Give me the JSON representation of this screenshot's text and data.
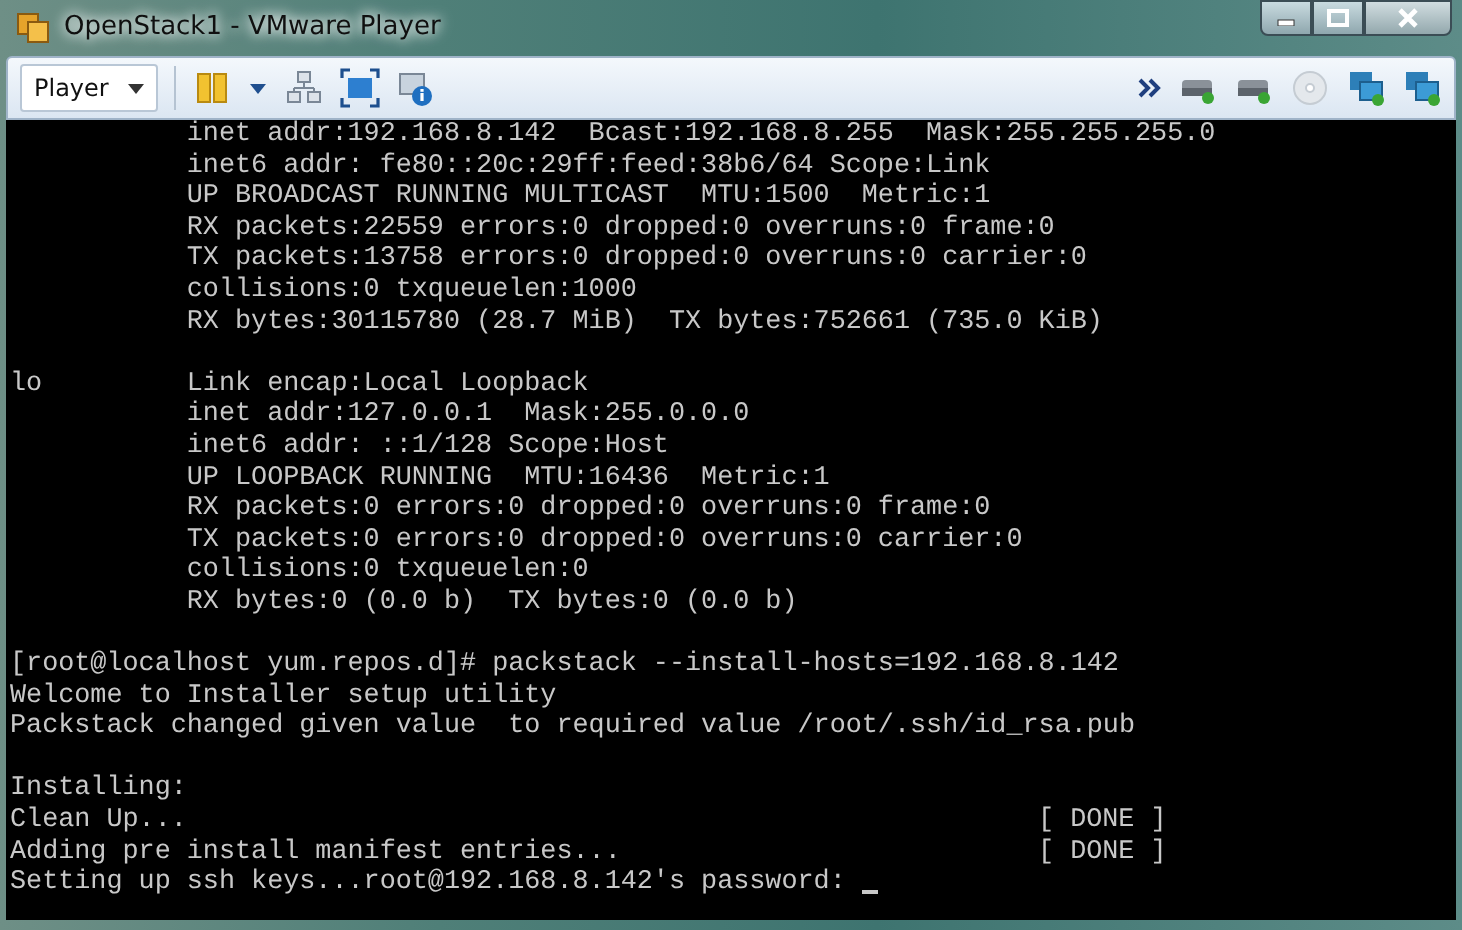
{
  "window": {
    "title": "OpenStack1 - VMware Player"
  },
  "toolbar": {
    "menu_label": "Player"
  },
  "terminal": {
    "blocks": [
      {
        "lines": [
          "           inet addr:192.168.8.142  Bcast:192.168.8.255  Mask:255.255.255.0",
          "           inet6 addr: fe80::20c:29ff:feed:38b6/64 Scope:Link",
          "           UP BROADCAST RUNNING MULTICAST  MTU:1500  Metric:1",
          "           RX packets:22559 errors:0 dropped:0 overruns:0 frame:0",
          "           TX packets:13758 errors:0 dropped:0 overruns:0 carrier:0",
          "           collisions:0 txqueuelen:1000",
          "           RX bytes:30115780 (28.7 MiB)  TX bytes:752661 (735.0 KiB)"
        ]
      },
      {
        "lines": [
          "lo         Link encap:Local Loopback",
          "           inet addr:127.0.0.1  Mask:255.0.0.0",
          "           inet6 addr: ::1/128 Scope:Host",
          "           UP LOOPBACK RUNNING  MTU:16436  Metric:1",
          "           RX packets:0 errors:0 dropped:0 overruns:0 frame:0",
          "           TX packets:0 errors:0 dropped:0 overruns:0 carrier:0",
          "           collisions:0 txqueuelen:0",
          "           RX bytes:0 (0.0 b)  TX bytes:0 (0.0 b)"
        ]
      },
      {
        "lines": [
          "[root@localhost yum.repos.d]# packstack --install-hosts=192.168.8.142",
          "Welcome to Installer setup utility",
          "Packstack changed given value  to required value /root/.ssh/id_rsa.pub"
        ]
      },
      {
        "lines": [
          "Installing:"
        ],
        "steps": [
          {
            "text": "Clean Up...",
            "status": "[ DONE ]"
          },
          {
            "text": "Adding pre install manifest entries...",
            "status": "[ DONE ]"
          }
        ],
        "prompt": {
          "text": "Setting up ssh keys...root@192.168.8.142's password:",
          "cursor": true
        }
      }
    ]
  }
}
